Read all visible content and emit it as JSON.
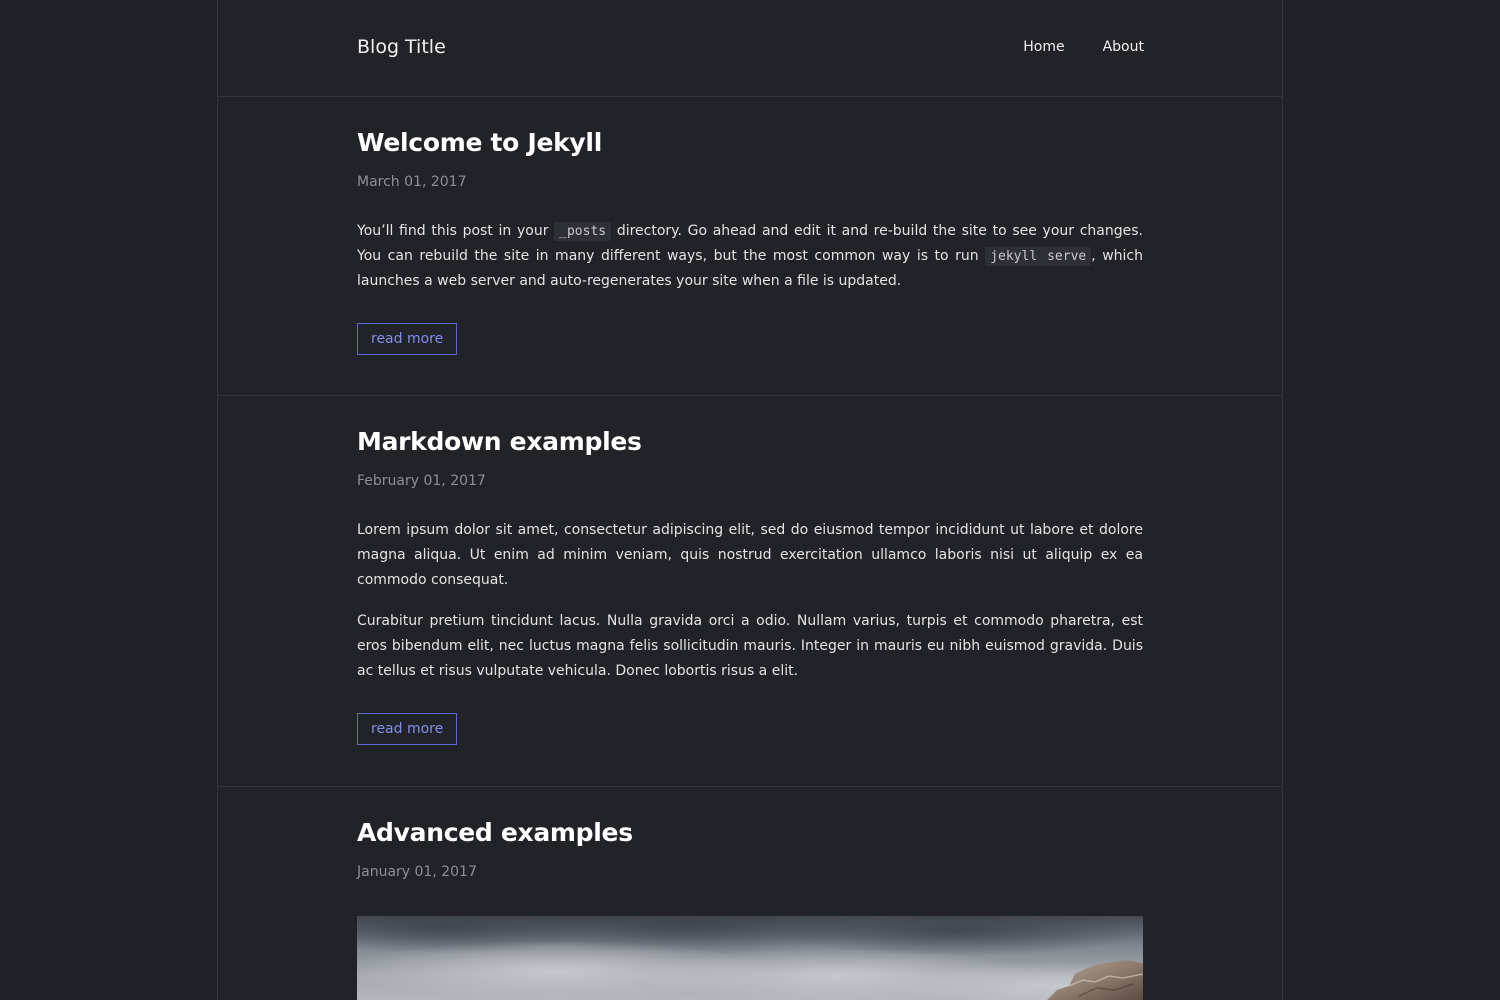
{
  "header": {
    "site_title": "Blog Title",
    "nav": [
      {
        "label": "Home"
      },
      {
        "label": "About"
      }
    ]
  },
  "posts": [
    {
      "title": "Welcome to Jekyll",
      "date": "March 01, 2017",
      "paragraph_parts": [
        "You’ll find this post in your ",
        "_posts",
        " directory. Go ahead and edit it and re-build the site to see your changes. You can rebuild the site in many different ways, but the most common way is to run ",
        "jekyll serve",
        ", which launches a web server and auto-regenerates your site when a file is updated."
      ],
      "read_more": "read more"
    },
    {
      "title": "Markdown examples",
      "date": "February 01, 2017",
      "paragraphs": [
        "Lorem ipsum dolor sit amet, consectetur adipiscing elit, sed do eiusmod tempor incididunt ut labore et dolore magna aliqua. Ut enim ad minim veniam, quis nostrud exercitation ullamco laboris nisi ut aliquip ex ea commodo consequat.",
        "Curabitur pretium tincidunt lacus. Nulla gravida orci a odio. Nullam varius, turpis et commodo pharetra, est eros bibendum elit, nec luctus magna felis sollicitudin mauris. Integer in mauris eu nibh euismod gravida. Duis ac tellus et risus vulputate vehicula. Donec lobortis risus a elit."
      ],
      "read_more": "read more"
    },
    {
      "title": "Advanced examples",
      "date": "January 01, 2017"
    }
  ],
  "colors": {
    "background": "#212227",
    "accent": "#7d8ef0",
    "border": "#34353b"
  }
}
